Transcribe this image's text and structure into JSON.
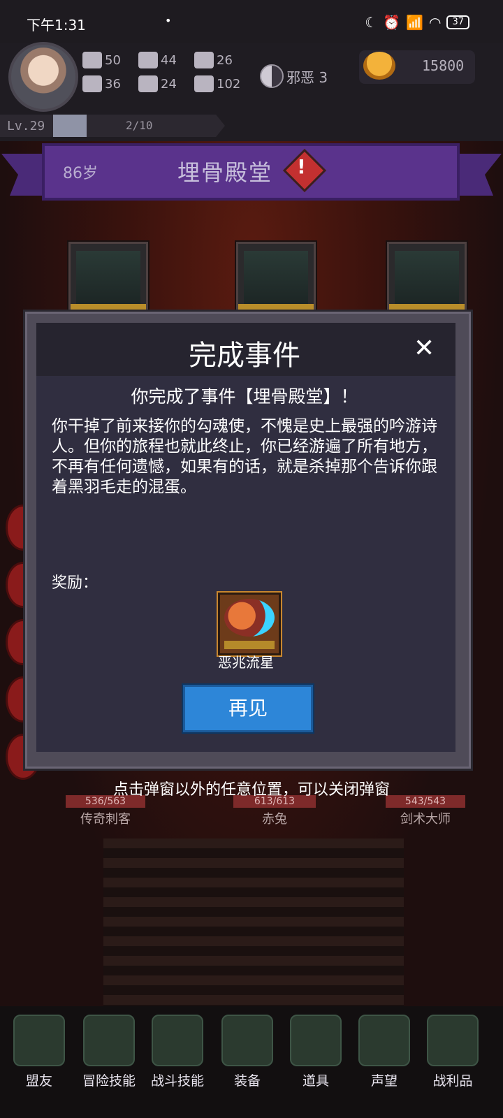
{
  "status_bar": {
    "time": "下午1:31",
    "battery": "37"
  },
  "player": {
    "stats": [
      {
        "icon": "fist-icon",
        "value": "50"
      },
      {
        "icon": "boot-icon",
        "value": "44"
      },
      {
        "icon": "wizard-hat-icon",
        "value": "26"
      },
      {
        "icon": "clover-icon",
        "value": "36"
      },
      {
        "icon": "armor-icon",
        "value": "24"
      },
      {
        "icon": "leaf-icon",
        "value": "102"
      }
    ],
    "alignment": "邪恶 3",
    "gold": "15800",
    "level": "Lv.29",
    "progress": "2/10",
    "progress_fraction": 0.2
  },
  "location": {
    "age": "86岁",
    "name": "埋骨殿堂"
  },
  "background_units": [
    {
      "hp": "536/563",
      "name": "传奇刺客"
    },
    {
      "hp": "613/613",
      "name": "赤兔"
    },
    {
      "hp": "543/543",
      "name": "剑术大师"
    }
  ],
  "hint": "点击弹窗以外的任意位置，可以关闭弹窗",
  "modal": {
    "title": "完成事件",
    "subtitle": "你完成了事件【埋骨殿堂】！",
    "body": "你干掉了前来接你的勾魂使，不愧是史上最强的吟游诗人。但你的旅程也就此终止，你已经游遍了所有地方，不再有任何遗憾，如果有的话，就是杀掉那个告诉你跟着黑羽毛走的混蛋。",
    "reward_label": "奖励：",
    "reward_item": "恶兆流星",
    "button": "再见"
  },
  "dock": [
    {
      "label": "盟友"
    },
    {
      "label": "冒险技能"
    },
    {
      "label": "战斗技能"
    },
    {
      "label": "装备"
    },
    {
      "label": "道具"
    },
    {
      "label": "声望"
    },
    {
      "label": "战利品"
    }
  ]
}
